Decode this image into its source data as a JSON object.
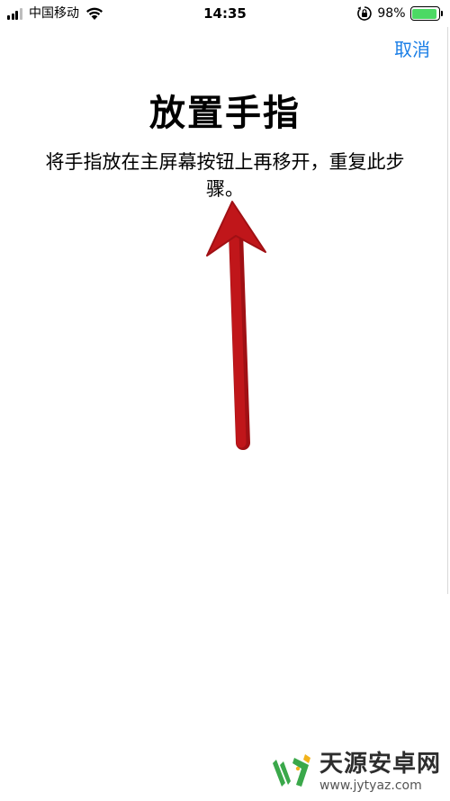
{
  "status_bar": {
    "carrier": "中国移动",
    "time": "14:35",
    "battery_percent": "98%",
    "battery_level": 0.98,
    "icons": [
      "signal-icon",
      "wifi-icon",
      "orientation-lock-icon",
      "battery-icon"
    ]
  },
  "nav": {
    "cancel_label": "取消"
  },
  "main": {
    "title": "放置手指",
    "instruction": "将手指放在主屏幕按钮上再移开，重复此步骤。"
  },
  "annotation": {
    "arrow_color": "#c0161a",
    "icon": "arrow-up-icon"
  },
  "watermark": {
    "name": "天源安卓网",
    "url": "www.jytyaz.com",
    "logo_colors": [
      "#3aa84a",
      "#f2b31b"
    ]
  },
  "colors": {
    "accent": "#1a7ee6",
    "battery_fill": "#4cd964"
  }
}
